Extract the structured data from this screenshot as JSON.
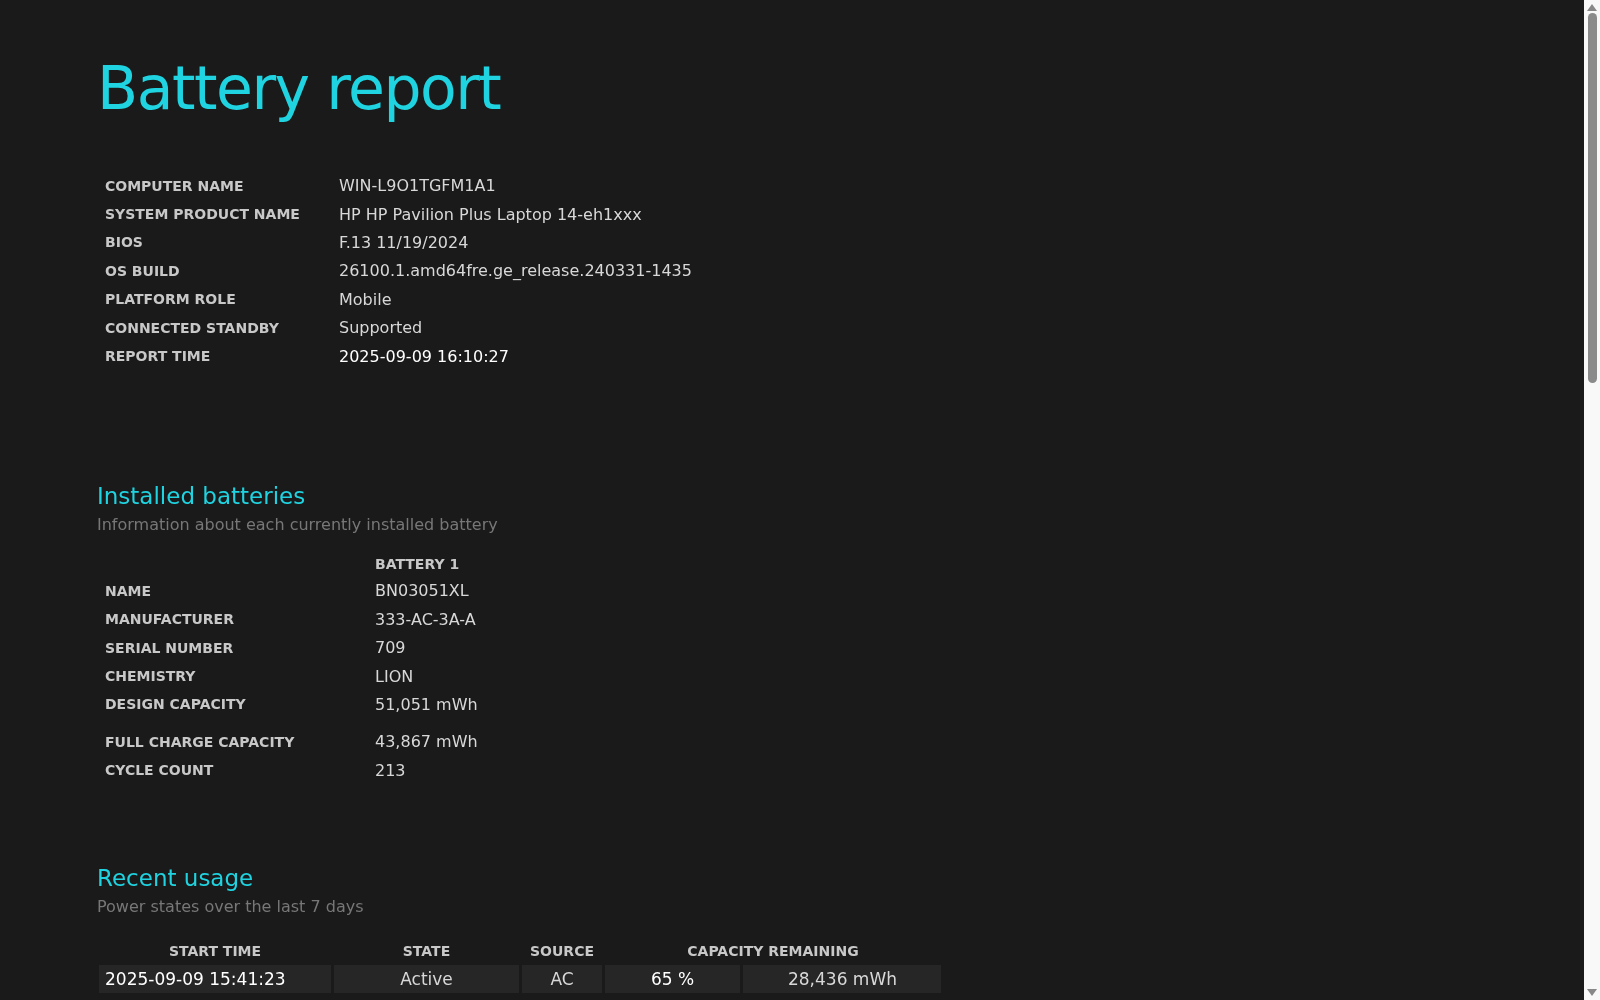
{
  "title": "Battery report",
  "system_info": [
    {
      "label": "COMPUTER NAME",
      "value": "WIN-L9O1TGFM1A1"
    },
    {
      "label": "SYSTEM PRODUCT NAME",
      "value": "HP HP Pavilion Plus Laptop 14-eh1xxx"
    },
    {
      "label": "BIOS",
      "value": "F.13 11/19/2024"
    },
    {
      "label": "OS BUILD",
      "value": "26100.1.amd64fre.ge_release.240331-1435"
    },
    {
      "label": "PLATFORM ROLE",
      "value": "Mobile"
    },
    {
      "label": "CONNECTED STANDBY",
      "value": "Supported"
    },
    {
      "label": "REPORT TIME",
      "value": "2025-09-09  16:10:27"
    }
  ],
  "installed_batteries": {
    "heading": "Installed batteries",
    "subtitle": "Information about each currently installed battery",
    "column": "BATTERY 1",
    "rows": [
      {
        "label": "NAME",
        "value": "BN03051XL"
      },
      {
        "label": "MANUFACTURER",
        "value": "333-AC-3A-A"
      },
      {
        "label": "SERIAL NUMBER",
        "value": "709"
      },
      {
        "label": "CHEMISTRY",
        "value": "LION"
      },
      {
        "label": "DESIGN CAPACITY",
        "value": "51,051 mWh"
      },
      {
        "label": "FULL CHARGE CAPACITY",
        "value": "43,867 mWh"
      },
      {
        "label": "CYCLE COUNT",
        "value": "213"
      }
    ]
  },
  "recent_usage": {
    "heading": "Recent usage",
    "subtitle": "Power states over the last 7 days",
    "columns": [
      "START TIME",
      "STATE",
      "SOURCE",
      "CAPACITY REMAINING"
    ],
    "rows": [
      {
        "start_time": "2025-09-09  15:41:23",
        "state": "Active",
        "source": "AC",
        "percent": "65 %",
        "capacity": "28,436 mWh"
      }
    ]
  }
}
